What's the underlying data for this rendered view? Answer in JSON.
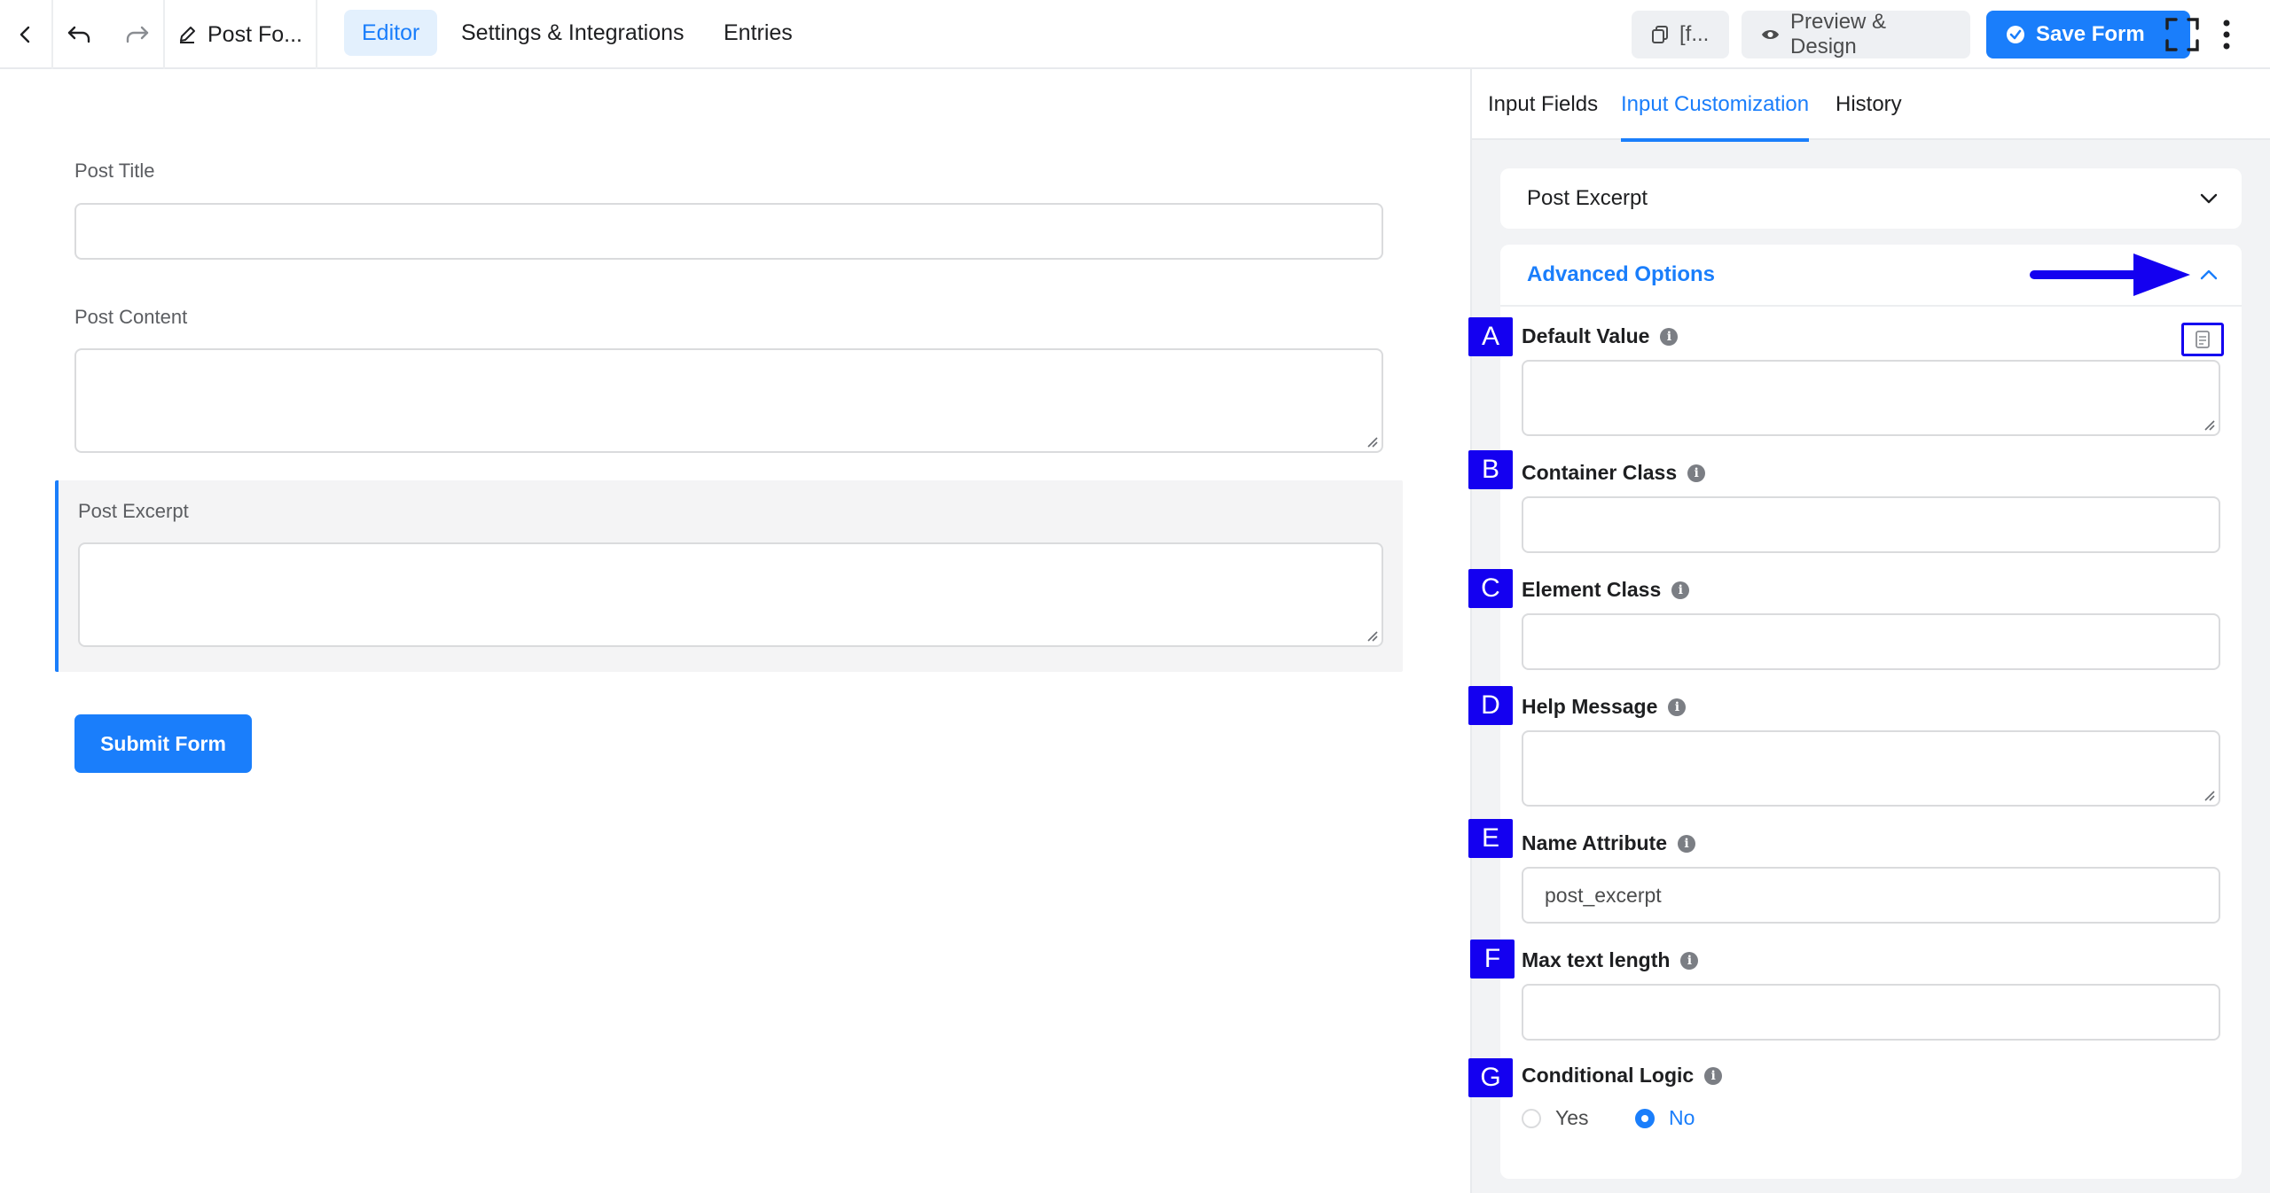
{
  "header": {
    "form_title": "Post Fo...",
    "tabs": [
      {
        "label": "Editor",
        "active": true
      },
      {
        "label": "Settings & Integrations",
        "active": false
      },
      {
        "label": "Entries",
        "active": false
      }
    ],
    "shortcode_label": "[f...",
    "preview_label": "Preview & Design",
    "save_label": "Save Form"
  },
  "form": {
    "fields": [
      {
        "label": "Post Title"
      },
      {
        "label": "Post Content"
      },
      {
        "label": "Post Excerpt"
      }
    ],
    "submit_label": "Submit Form"
  },
  "panel": {
    "tabs": [
      {
        "label": "Input Fields",
        "active": false
      },
      {
        "label": "Input Customization",
        "active": true
      },
      {
        "label": "History",
        "active": false
      }
    ],
    "field_select": "Post Excerpt",
    "advanced_title": "Advanced Options",
    "options": [
      {
        "badge": "A",
        "label": "Default Value",
        "value": ""
      },
      {
        "badge": "B",
        "label": "Container Class",
        "value": ""
      },
      {
        "badge": "C",
        "label": "Element Class",
        "value": ""
      },
      {
        "badge": "D",
        "label": "Help Message",
        "value": ""
      },
      {
        "badge": "E",
        "label": "Name Attribute",
        "value": "post_excerpt"
      },
      {
        "badge": "F",
        "label": "Max text length",
        "value": ""
      },
      {
        "badge": "G",
        "label": "Conditional Logic"
      }
    ],
    "conditional": {
      "yes": "Yes",
      "no": "No",
      "selected": "No"
    }
  },
  "colors": {
    "accent": "#1a7efb",
    "annotation": "#1400f0",
    "panel_bg": "#f2f3f5"
  }
}
